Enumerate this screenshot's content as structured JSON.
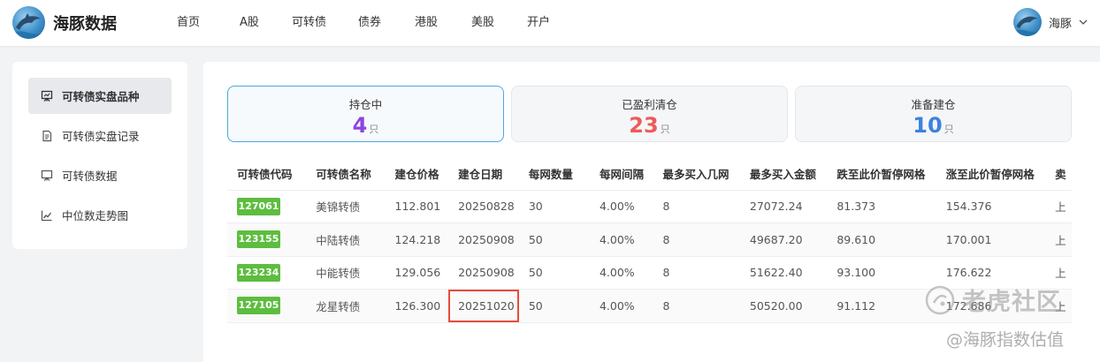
{
  "app": {
    "brand": "海豚数据"
  },
  "nav": {
    "items": [
      "首页",
      "A股",
      "可转债",
      "债券",
      "港股",
      "美股",
      "开户"
    ]
  },
  "user": {
    "name": "海豚"
  },
  "sidebar": {
    "items": [
      {
        "label": "可转债实盘品种",
        "icon": "easel-icon",
        "active": true
      },
      {
        "label": "可转债实盘记录",
        "icon": "document-icon",
        "active": false
      },
      {
        "label": "可转债数据",
        "icon": "easel-icon",
        "active": false
      },
      {
        "label": "中位数走势图",
        "icon": "trend-chart-icon",
        "active": false
      }
    ]
  },
  "cards": [
    {
      "label": "持仓中",
      "value": "4",
      "unit": "只",
      "color": "#8e44e0",
      "active": true
    },
    {
      "label": "已盈利清仓",
      "value": "23",
      "unit": "只",
      "color": "#ee5a5a",
      "active": false
    },
    {
      "label": "准备建仓",
      "value": "10",
      "unit": "只",
      "color": "#3b82e0",
      "active": false
    }
  ],
  "table": {
    "headers": [
      "可转债代码",
      "可转债名称",
      "建仓价格",
      "建仓日期",
      "每网数量",
      "每网间隔",
      "最多买入几网",
      "最多买入金额",
      "跌至此价暂停网格",
      "涨至此价暂停网格",
      "卖"
    ],
    "rows": [
      [
        "127061",
        "美锦转债",
        "112.801",
        "20250828",
        "30",
        "4.00%",
        "8",
        "27072.24",
        "81.373",
        "154.376",
        "上"
      ],
      [
        "123155",
        "中陆转债",
        "124.218",
        "20250908",
        "50",
        "4.00%",
        "8",
        "49687.20",
        "89.610",
        "170.001",
        "上"
      ],
      [
        "123234",
        "中能转债",
        "129.056",
        "20250908",
        "50",
        "4.00%",
        "8",
        "51622.40",
        "93.100",
        "176.622",
        "上"
      ],
      [
        "127105",
        "龙星转债",
        "126.300",
        "20251020",
        "50",
        "4.00%",
        "8",
        "50520.00",
        "91.112",
        "172.686",
        "上"
      ]
    ],
    "highlight": {
      "row": 3,
      "col": 3,
      "color": "#e74c3c"
    }
  },
  "watermark": {
    "line1": "老虎社区",
    "line2": "@海豚指数估值"
  },
  "colors": {
    "tag_green": "#5dbd3f",
    "active_border": "#4aa8e0"
  }
}
